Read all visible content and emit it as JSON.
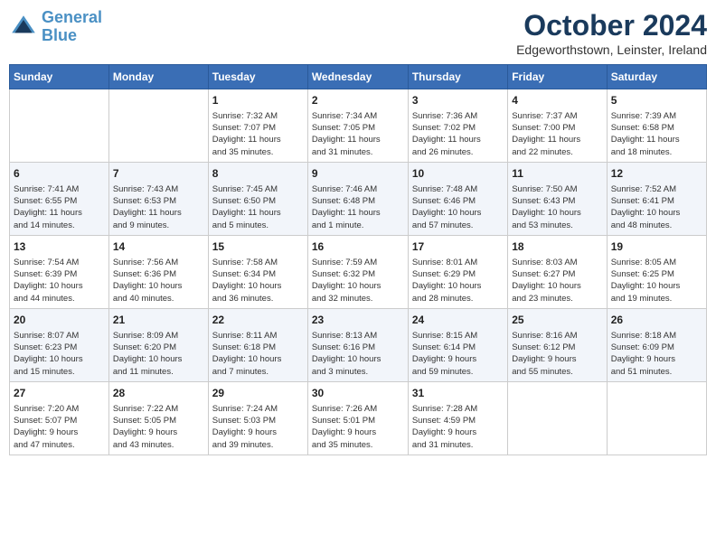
{
  "header": {
    "logo_line1": "General",
    "logo_line2": "Blue",
    "month": "October 2024",
    "location": "Edgeworthstown, Leinster, Ireland"
  },
  "weekdays": [
    "Sunday",
    "Monday",
    "Tuesday",
    "Wednesday",
    "Thursday",
    "Friday",
    "Saturday"
  ],
  "weeks": [
    [
      {
        "day": "",
        "info": ""
      },
      {
        "day": "",
        "info": ""
      },
      {
        "day": "1",
        "info": "Sunrise: 7:32 AM\nSunset: 7:07 PM\nDaylight: 11 hours\nand 35 minutes."
      },
      {
        "day": "2",
        "info": "Sunrise: 7:34 AM\nSunset: 7:05 PM\nDaylight: 11 hours\nand 31 minutes."
      },
      {
        "day": "3",
        "info": "Sunrise: 7:36 AM\nSunset: 7:02 PM\nDaylight: 11 hours\nand 26 minutes."
      },
      {
        "day": "4",
        "info": "Sunrise: 7:37 AM\nSunset: 7:00 PM\nDaylight: 11 hours\nand 22 minutes."
      },
      {
        "day": "5",
        "info": "Sunrise: 7:39 AM\nSunset: 6:58 PM\nDaylight: 11 hours\nand 18 minutes."
      }
    ],
    [
      {
        "day": "6",
        "info": "Sunrise: 7:41 AM\nSunset: 6:55 PM\nDaylight: 11 hours\nand 14 minutes."
      },
      {
        "day": "7",
        "info": "Sunrise: 7:43 AM\nSunset: 6:53 PM\nDaylight: 11 hours\nand 9 minutes."
      },
      {
        "day": "8",
        "info": "Sunrise: 7:45 AM\nSunset: 6:50 PM\nDaylight: 11 hours\nand 5 minutes."
      },
      {
        "day": "9",
        "info": "Sunrise: 7:46 AM\nSunset: 6:48 PM\nDaylight: 11 hours\nand 1 minute."
      },
      {
        "day": "10",
        "info": "Sunrise: 7:48 AM\nSunset: 6:46 PM\nDaylight: 10 hours\nand 57 minutes."
      },
      {
        "day": "11",
        "info": "Sunrise: 7:50 AM\nSunset: 6:43 PM\nDaylight: 10 hours\nand 53 minutes."
      },
      {
        "day": "12",
        "info": "Sunrise: 7:52 AM\nSunset: 6:41 PM\nDaylight: 10 hours\nand 48 minutes."
      }
    ],
    [
      {
        "day": "13",
        "info": "Sunrise: 7:54 AM\nSunset: 6:39 PM\nDaylight: 10 hours\nand 44 minutes."
      },
      {
        "day": "14",
        "info": "Sunrise: 7:56 AM\nSunset: 6:36 PM\nDaylight: 10 hours\nand 40 minutes."
      },
      {
        "day": "15",
        "info": "Sunrise: 7:58 AM\nSunset: 6:34 PM\nDaylight: 10 hours\nand 36 minutes."
      },
      {
        "day": "16",
        "info": "Sunrise: 7:59 AM\nSunset: 6:32 PM\nDaylight: 10 hours\nand 32 minutes."
      },
      {
        "day": "17",
        "info": "Sunrise: 8:01 AM\nSunset: 6:29 PM\nDaylight: 10 hours\nand 28 minutes."
      },
      {
        "day": "18",
        "info": "Sunrise: 8:03 AM\nSunset: 6:27 PM\nDaylight: 10 hours\nand 23 minutes."
      },
      {
        "day": "19",
        "info": "Sunrise: 8:05 AM\nSunset: 6:25 PM\nDaylight: 10 hours\nand 19 minutes."
      }
    ],
    [
      {
        "day": "20",
        "info": "Sunrise: 8:07 AM\nSunset: 6:23 PM\nDaylight: 10 hours\nand 15 minutes."
      },
      {
        "day": "21",
        "info": "Sunrise: 8:09 AM\nSunset: 6:20 PM\nDaylight: 10 hours\nand 11 minutes."
      },
      {
        "day": "22",
        "info": "Sunrise: 8:11 AM\nSunset: 6:18 PM\nDaylight: 10 hours\nand 7 minutes."
      },
      {
        "day": "23",
        "info": "Sunrise: 8:13 AM\nSunset: 6:16 PM\nDaylight: 10 hours\nand 3 minutes."
      },
      {
        "day": "24",
        "info": "Sunrise: 8:15 AM\nSunset: 6:14 PM\nDaylight: 9 hours\nand 59 minutes."
      },
      {
        "day": "25",
        "info": "Sunrise: 8:16 AM\nSunset: 6:12 PM\nDaylight: 9 hours\nand 55 minutes."
      },
      {
        "day": "26",
        "info": "Sunrise: 8:18 AM\nSunset: 6:09 PM\nDaylight: 9 hours\nand 51 minutes."
      }
    ],
    [
      {
        "day": "27",
        "info": "Sunrise: 7:20 AM\nSunset: 5:07 PM\nDaylight: 9 hours\nand 47 minutes."
      },
      {
        "day": "28",
        "info": "Sunrise: 7:22 AM\nSunset: 5:05 PM\nDaylight: 9 hours\nand 43 minutes."
      },
      {
        "day": "29",
        "info": "Sunrise: 7:24 AM\nSunset: 5:03 PM\nDaylight: 9 hours\nand 39 minutes."
      },
      {
        "day": "30",
        "info": "Sunrise: 7:26 AM\nSunset: 5:01 PM\nDaylight: 9 hours\nand 35 minutes."
      },
      {
        "day": "31",
        "info": "Sunrise: 7:28 AM\nSunset: 4:59 PM\nDaylight: 9 hours\nand 31 minutes."
      },
      {
        "day": "",
        "info": ""
      },
      {
        "day": "",
        "info": ""
      }
    ]
  ]
}
